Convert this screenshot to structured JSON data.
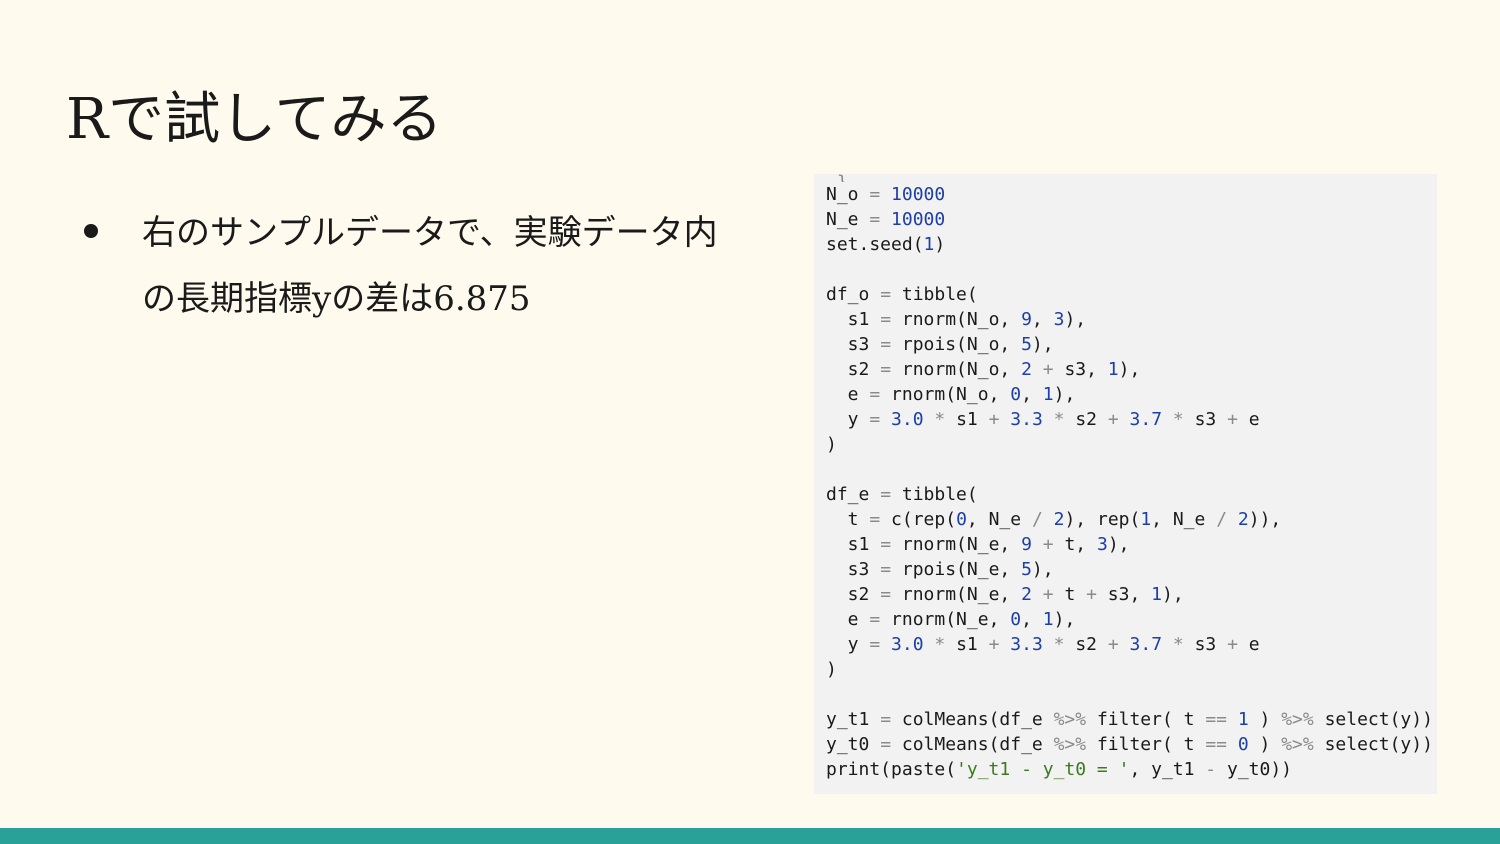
{
  "slide": {
    "title": "Rで試してみる",
    "bullets": [
      {
        "line1": "右のサンプルデータで、実験データ内",
        "line2": "の長期指標yの差は6.875"
      }
    ]
  },
  "code": {
    "language": "R",
    "cut_top_line": [
      [
        " ",
        "t"
      ],
      [
        "}",
        "o"
      ]
    ],
    "lines": [
      [
        [
          "N_o ",
          "t"
        ],
        [
          "=",
          "o"
        ],
        [
          " ",
          "t"
        ],
        [
          "10000",
          "n"
        ]
      ],
      [
        [
          "N_e ",
          "t"
        ],
        [
          "=",
          "o"
        ],
        [
          " ",
          "t"
        ],
        [
          "10000",
          "n"
        ]
      ],
      [
        [
          "set.seed(",
          "t"
        ],
        [
          "1",
          "n"
        ],
        [
          ")",
          "t"
        ]
      ],
      [],
      [
        [
          "df_o ",
          "t"
        ],
        [
          "=",
          "o"
        ],
        [
          " tibble(",
          "t"
        ]
      ],
      [
        [
          "  s1 ",
          "t"
        ],
        [
          "=",
          "o"
        ],
        [
          " rnorm(N_o, ",
          "t"
        ],
        [
          "9",
          "n"
        ],
        [
          ", ",
          "t"
        ],
        [
          "3",
          "n"
        ],
        [
          "),",
          "t"
        ]
      ],
      [
        [
          "  s3 ",
          "t"
        ],
        [
          "=",
          "o"
        ],
        [
          " rpois(N_o, ",
          "t"
        ],
        [
          "5",
          "n"
        ],
        [
          "),",
          "t"
        ]
      ],
      [
        [
          "  s2 ",
          "t"
        ],
        [
          "=",
          "o"
        ],
        [
          " rnorm(N_o, ",
          "t"
        ],
        [
          "2",
          "n"
        ],
        [
          " ",
          "t"
        ],
        [
          "+",
          "o"
        ],
        [
          " s3, ",
          "t"
        ],
        [
          "1",
          "n"
        ],
        [
          "),",
          "t"
        ]
      ],
      [
        [
          "  e ",
          "t"
        ],
        [
          "=",
          "o"
        ],
        [
          " rnorm(N_o, ",
          "t"
        ],
        [
          "0",
          "n"
        ],
        [
          ", ",
          "t"
        ],
        [
          "1",
          "n"
        ],
        [
          "),",
          "t"
        ]
      ],
      [
        [
          "  y ",
          "t"
        ],
        [
          "=",
          "o"
        ],
        [
          " ",
          "t"
        ],
        [
          "3.0",
          "n"
        ],
        [
          " ",
          "t"
        ],
        [
          "*",
          "o"
        ],
        [
          " s1 ",
          "t"
        ],
        [
          "+",
          "o"
        ],
        [
          " ",
          "t"
        ],
        [
          "3.3",
          "n"
        ],
        [
          " ",
          "t"
        ],
        [
          "*",
          "o"
        ],
        [
          " s2 ",
          "t"
        ],
        [
          "+",
          "o"
        ],
        [
          " ",
          "t"
        ],
        [
          "3.7",
          "n"
        ],
        [
          " ",
          "t"
        ],
        [
          "*",
          "o"
        ],
        [
          " s3 ",
          "t"
        ],
        [
          "+",
          "o"
        ],
        [
          " e",
          "t"
        ]
      ],
      [
        [
          ")",
          "t"
        ]
      ],
      [],
      [
        [
          "df_e ",
          "t"
        ],
        [
          "=",
          "o"
        ],
        [
          " tibble(",
          "t"
        ]
      ],
      [
        [
          "  t ",
          "t"
        ],
        [
          "=",
          "o"
        ],
        [
          " c(rep(",
          "t"
        ],
        [
          "0",
          "n"
        ],
        [
          ", N_e ",
          "t"
        ],
        [
          "/",
          "o"
        ],
        [
          " ",
          "t"
        ],
        [
          "2",
          "n"
        ],
        [
          "), rep(",
          "t"
        ],
        [
          "1",
          "n"
        ],
        [
          ", N_e ",
          "t"
        ],
        [
          "/",
          "o"
        ],
        [
          " ",
          "t"
        ],
        [
          "2",
          "n"
        ],
        [
          ")),",
          "t"
        ]
      ],
      [
        [
          "  s1 ",
          "t"
        ],
        [
          "=",
          "o"
        ],
        [
          " rnorm(N_e, ",
          "t"
        ],
        [
          "9",
          "n"
        ],
        [
          " ",
          "t"
        ],
        [
          "+",
          "o"
        ],
        [
          " t, ",
          "t"
        ],
        [
          "3",
          "n"
        ],
        [
          "),",
          "t"
        ]
      ],
      [
        [
          "  s3 ",
          "t"
        ],
        [
          "=",
          "o"
        ],
        [
          " rpois(N_e, ",
          "t"
        ],
        [
          "5",
          "n"
        ],
        [
          "),",
          "t"
        ]
      ],
      [
        [
          "  s2 ",
          "t"
        ],
        [
          "=",
          "o"
        ],
        [
          " rnorm(N_e, ",
          "t"
        ],
        [
          "2",
          "n"
        ],
        [
          " ",
          "t"
        ],
        [
          "+",
          "o"
        ],
        [
          " t ",
          "t"
        ],
        [
          "+",
          "o"
        ],
        [
          " s3, ",
          "t"
        ],
        [
          "1",
          "n"
        ],
        [
          "),",
          "t"
        ]
      ],
      [
        [
          "  e ",
          "t"
        ],
        [
          "=",
          "o"
        ],
        [
          " rnorm(N_e, ",
          "t"
        ],
        [
          "0",
          "n"
        ],
        [
          ", ",
          "t"
        ],
        [
          "1",
          "n"
        ],
        [
          "),",
          "t"
        ]
      ],
      [
        [
          "  y ",
          "t"
        ],
        [
          "=",
          "o"
        ],
        [
          " ",
          "t"
        ],
        [
          "3.0",
          "n"
        ],
        [
          " ",
          "t"
        ],
        [
          "*",
          "o"
        ],
        [
          " s1 ",
          "t"
        ],
        [
          "+",
          "o"
        ],
        [
          " ",
          "t"
        ],
        [
          "3.3",
          "n"
        ],
        [
          " ",
          "t"
        ],
        [
          "*",
          "o"
        ],
        [
          " s2 ",
          "t"
        ],
        [
          "+",
          "o"
        ],
        [
          " ",
          "t"
        ],
        [
          "3.7",
          "n"
        ],
        [
          " ",
          "t"
        ],
        [
          "*",
          "o"
        ],
        [
          " s3 ",
          "t"
        ],
        [
          "+",
          "o"
        ],
        [
          " e",
          "t"
        ]
      ],
      [
        [
          ")",
          "t"
        ]
      ],
      [],
      [
        [
          "y_t1 ",
          "t"
        ],
        [
          "=",
          "o"
        ],
        [
          " colMeans(df_e ",
          "t"
        ],
        [
          "%>%",
          "o"
        ],
        [
          " filter( t ",
          "t"
        ],
        [
          "==",
          "o"
        ],
        [
          " ",
          "t"
        ],
        [
          "1",
          "n"
        ],
        [
          " ) ",
          "t"
        ],
        [
          "%>%",
          "o"
        ],
        [
          " select(y))",
          "t"
        ]
      ],
      [
        [
          "y_t0 ",
          "t"
        ],
        [
          "=",
          "o"
        ],
        [
          " colMeans(df_e ",
          "t"
        ],
        [
          "%>%",
          "o"
        ],
        [
          " filter( t ",
          "t"
        ],
        [
          "==",
          "o"
        ],
        [
          " ",
          "t"
        ],
        [
          "0",
          "n"
        ],
        [
          " ) ",
          "t"
        ],
        [
          "%>%",
          "o"
        ],
        [
          " select(y))",
          "t"
        ]
      ],
      [
        [
          "print(paste(",
          "t"
        ],
        [
          "'y_t1 - y_t0 = '",
          "s"
        ],
        [
          ", y_t1 ",
          "t"
        ],
        [
          "-",
          "o"
        ],
        [
          " y_t0))",
          "t"
        ]
      ]
    ]
  },
  "colors": {
    "background": "#fefaee",
    "footer_bar": "#2aa198",
    "code_background": "#f2f2f2",
    "number_token": "#1c3fa8",
    "string_token": "#3b7a1e",
    "operator_token": "#8a8a8a"
  }
}
